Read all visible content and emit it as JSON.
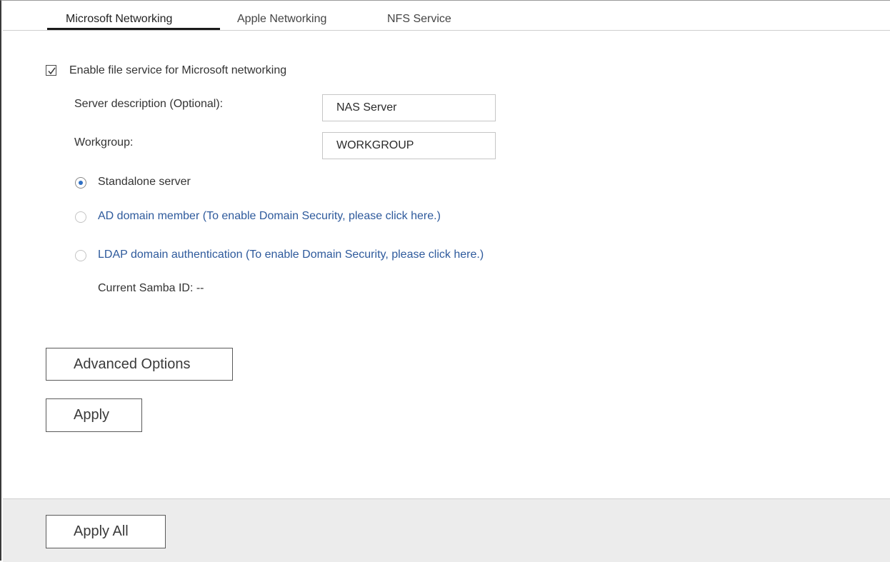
{
  "tabs": [
    {
      "label": "Microsoft Networking",
      "active": true
    },
    {
      "label": "Apple Networking",
      "active": false
    },
    {
      "label": "NFS Service",
      "active": false
    }
  ],
  "enable_service": {
    "label": "Enable file service for Microsoft networking",
    "checked": true
  },
  "server_description": {
    "label": "Server description (Optional):",
    "value": "NAS Server"
  },
  "workgroup": {
    "label": "Workgroup:",
    "value": "WORKGROUP"
  },
  "mode_options": [
    {
      "label": "Standalone server",
      "link": "",
      "selected": true
    },
    {
      "label": "AD domain member",
      "link": "(To enable Domain Security, please click here.)",
      "selected": false
    },
    {
      "label": "LDAP domain authentication",
      "link": "(To enable Domain Security, please click here.)",
      "selected": false
    }
  ],
  "samba_id": "Current Samba ID: --",
  "buttons": {
    "advanced_options": "Advanced Options",
    "apply": "Apply",
    "apply_all": "Apply All"
  },
  "colors": {
    "link": "#2e5a9c",
    "radio_selected": "#2f6fc4",
    "footer_bg": "#ececec"
  }
}
